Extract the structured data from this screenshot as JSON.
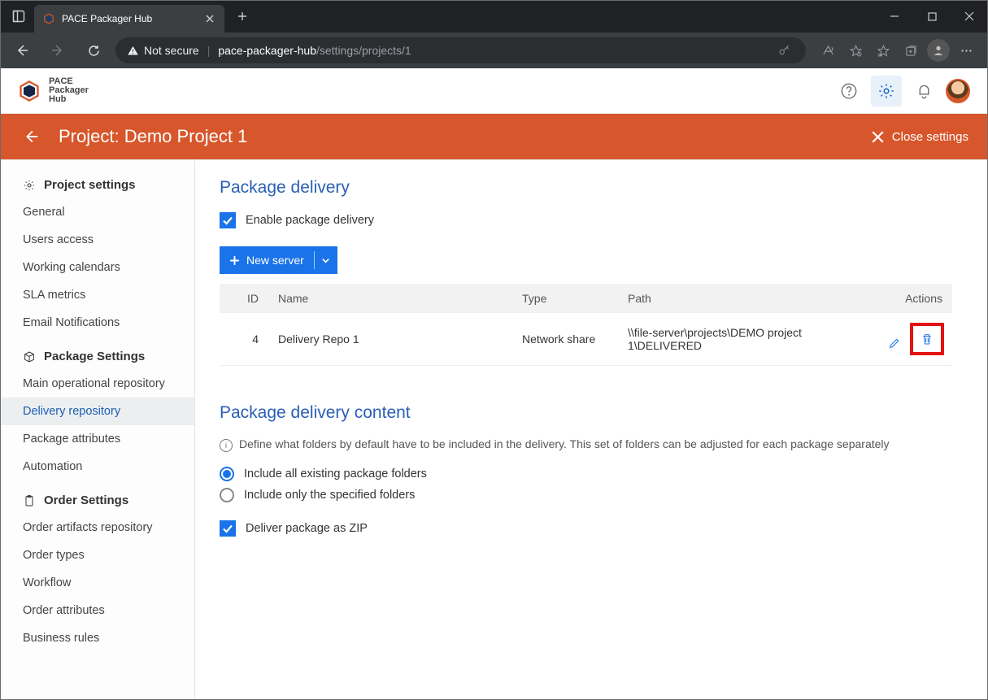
{
  "browser": {
    "tab_title": "PACE Packager Hub",
    "not_secure": "Not secure",
    "url_host": "pace-packager-hub",
    "url_path": "/settings/projects/1"
  },
  "app": {
    "logo_line1": "PACE",
    "logo_line2": "Packager",
    "logo_line3": "Hub"
  },
  "titlebar": {
    "heading": "Project: Demo Project 1",
    "close_label": "Close settings"
  },
  "sidebar": {
    "group1_title": "Project settings",
    "group1_items": [
      "General",
      "Users access",
      "Working calendars",
      "SLA metrics",
      "Email Notifications"
    ],
    "group2_title": "Package Settings",
    "group2_items": [
      "Main operational repository",
      "Delivery repository",
      "Package attributes",
      "Automation"
    ],
    "group3_title": "Order Settings",
    "group3_items": [
      "Order artifacts repository",
      "Order types",
      "Workflow",
      "Order attributes",
      "Business rules"
    ]
  },
  "main": {
    "section1_title": "Package delivery",
    "enable_label": "Enable package delivery",
    "new_server_label": "New server",
    "table_headers": {
      "id": "ID",
      "name": "Name",
      "type": "Type",
      "path": "Path",
      "actions": "Actions"
    },
    "row": {
      "id": "4",
      "name": "Delivery Repo 1",
      "type": "Network share",
      "path": "\\\\file-server\\projects\\DEMO project 1\\DELIVERED"
    },
    "section2_title": "Package delivery content",
    "info_text": "Define what folders by default have to be included in the delivery. This set of folders can be adjusted for each package separately",
    "radio1": "Include all existing package folders",
    "radio2": "Include only the specified folders",
    "zip_label": "Deliver package as ZIP"
  }
}
